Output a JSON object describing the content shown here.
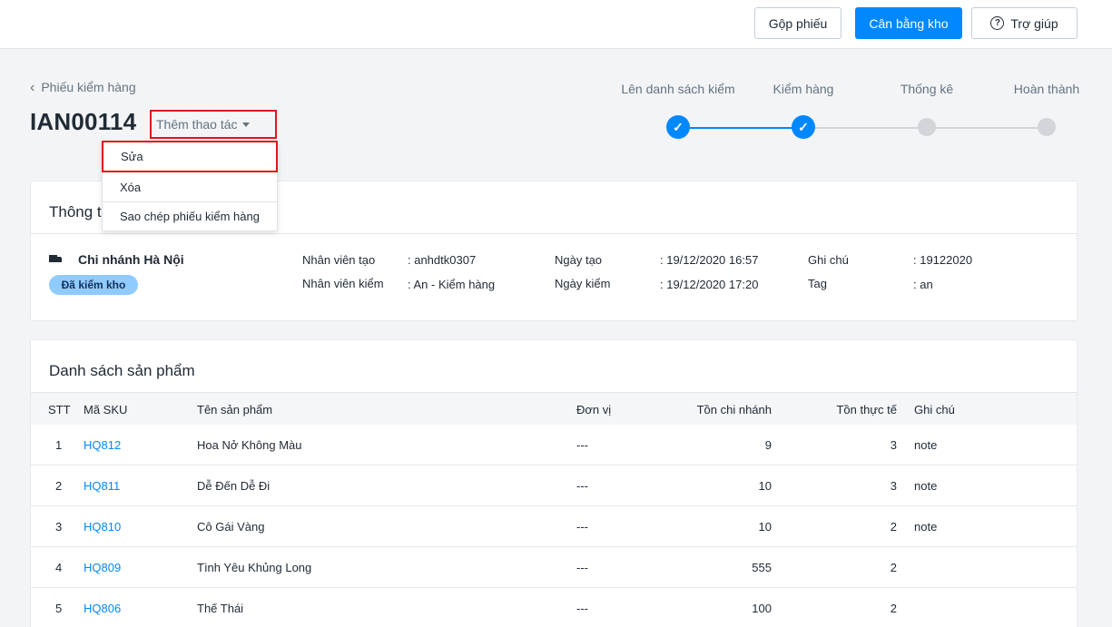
{
  "toolbar": {
    "merge_label": "Gộp phiếu",
    "balance_label": "Cân bằng kho",
    "help_label": "Trợ giúp"
  },
  "header": {
    "back_label": "Phiếu kiểm hàng",
    "title": "IAN00114",
    "more_actions_label": "Thêm thao tác"
  },
  "dropdown": {
    "items": [
      "Sửa",
      "Xóa",
      "Sao chép phiếu kiểm hàng"
    ]
  },
  "stepper": {
    "steps": [
      {
        "label": "Lên danh sách kiểm",
        "state": "done"
      },
      {
        "label": "Kiểm hàng",
        "state": "done"
      },
      {
        "label": "Thống kê",
        "state": "todo"
      },
      {
        "label": "Hoàn thành",
        "state": "todo"
      }
    ]
  },
  "info": {
    "title": "Thông tin",
    "branch": "Chi nhánh Hà Nội",
    "status_badge": "Đã kiểm kho",
    "created_by_label": "Nhân viên tạo",
    "created_by_value": ": anhdtk0307",
    "checked_by_label": "Nhân viên kiểm",
    "checked_by_value": ": An - Kiểm hàng",
    "created_date_label": "Ngày tạo",
    "created_date_value": ": 19/12/2020 16:57",
    "checked_date_label": "Ngày kiểm",
    "checked_date_value": ": 19/12/2020 17:20",
    "note_label": "Ghi chú",
    "note_value": ": 19122020",
    "tag_label": "Tag",
    "tag_value": ": an"
  },
  "products": {
    "title": "Danh sách sản phẩm",
    "columns": [
      "STT",
      "Mã SKU",
      "Tên sản phẩm",
      "Đơn vị",
      "Tồn chi nhánh",
      "Tồn thực tế",
      "Ghi chú"
    ],
    "rows": [
      {
        "stt": "1",
        "sku": "HQ812",
        "name": "Hoa Nở Không Màu",
        "unit": "---",
        "branch_stock": "9",
        "actual_stock": "3",
        "note": "note"
      },
      {
        "stt": "2",
        "sku": "HQ811",
        "name": "Dễ Đến Dễ Đi",
        "unit": "---",
        "branch_stock": "10",
        "actual_stock": "3",
        "note": "note"
      },
      {
        "stt": "3",
        "sku": "HQ810",
        "name": "Cô Gái Vàng",
        "unit": "---",
        "branch_stock": "10",
        "actual_stock": "2",
        "note": "note"
      },
      {
        "stt": "4",
        "sku": "HQ809",
        "name": "Tình Yêu Khủng Long",
        "unit": "---",
        "branch_stock": "555",
        "actual_stock": "2",
        "note": ""
      },
      {
        "stt": "5",
        "sku": "HQ806",
        "name": "Thế Thái",
        "unit": "---",
        "branch_stock": "100",
        "actual_stock": "2",
        "note": ""
      }
    ]
  },
  "colors": {
    "accent": "#0088ff",
    "highlight": "#e0161e",
    "badge": "#8fcbff"
  }
}
